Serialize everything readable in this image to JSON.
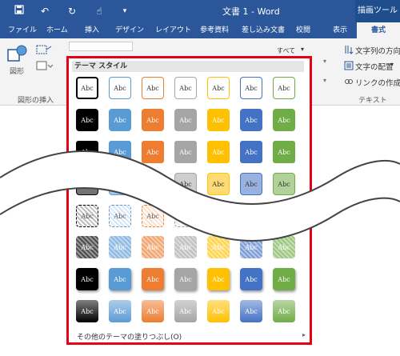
{
  "titlebar": {
    "doc_title": "文書 1 - Word",
    "tool_header": "描画ツール",
    "accent": "#2b579a"
  },
  "tabs": [
    {
      "label": "ファイル"
    },
    {
      "label": "ホーム"
    },
    {
      "label": "挿入"
    },
    {
      "label": "デザイン"
    },
    {
      "label": "レイアウト"
    },
    {
      "label": "参考資料"
    },
    {
      "label": "差し込み文書"
    },
    {
      "label": "校閲"
    },
    {
      "label": "表示"
    },
    {
      "label": "書式"
    }
  ],
  "ribbon": {
    "shape_label": "図形",
    "insert_shapes_group": "図形の挿入",
    "style_selector": "すべて",
    "text_direction": "文字列の方向",
    "text_align": "文字の配置",
    "create_link": "リンクの作成",
    "text_group": "テキスト"
  },
  "document": {
    "side_text": "テキスト"
  },
  "gallery": {
    "header": "テーマ スタイル",
    "swatch_text": "Abc",
    "more_fills": "その他のテーマの塗りつぶし(O)",
    "theme_colors": [
      "#000000",
      "#5b9bd5",
      "#ed7d31",
      "#a5a5a5",
      "#ffc000",
      "#4472c4",
      "#70ad47"
    ]
  }
}
